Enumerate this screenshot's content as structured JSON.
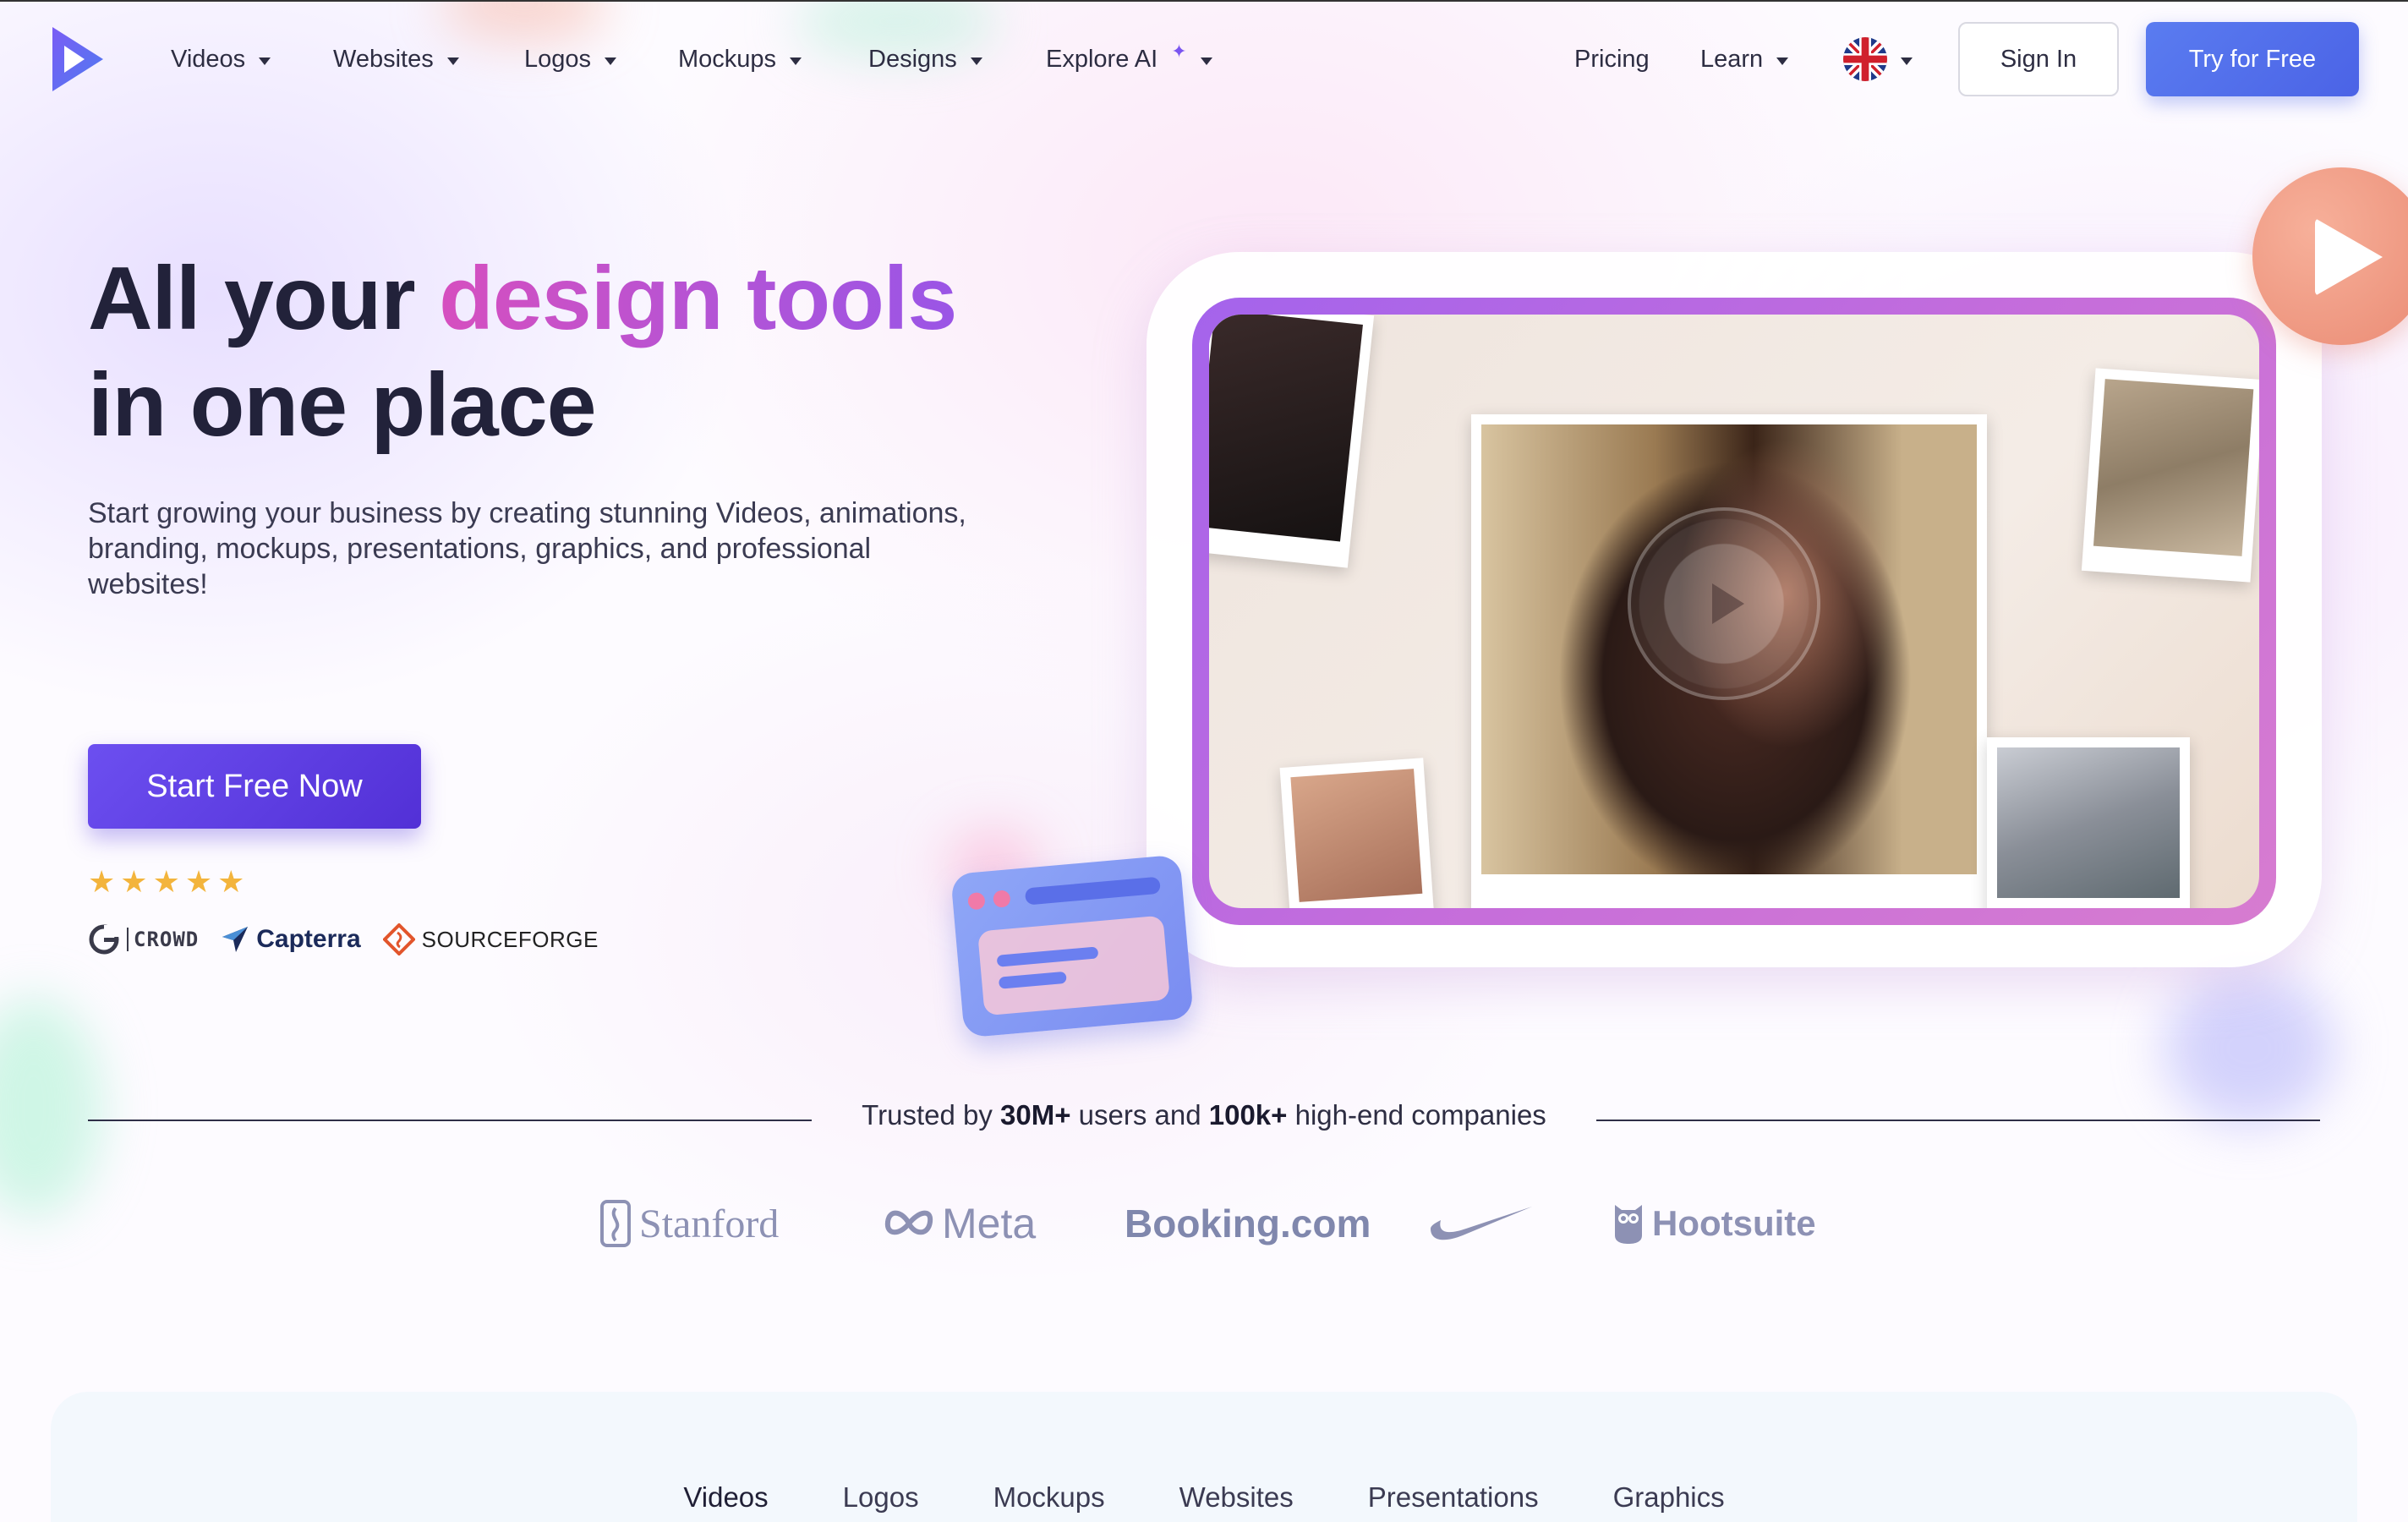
{
  "nav": {
    "items": [
      {
        "label": "Videos"
      },
      {
        "label": "Websites"
      },
      {
        "label": "Logos"
      },
      {
        "label": "Mockups"
      },
      {
        "label": "Designs"
      },
      {
        "label": "Explore AI"
      }
    ],
    "pricing": "Pricing",
    "learn": "Learn",
    "language_flag": "uk-flag-icon",
    "sign_in": "Sign In",
    "try_free": "Try for Free"
  },
  "hero": {
    "title_part1": "All your ",
    "title_highlight": "design tools",
    "title_part2": "in one place",
    "subtitle": "Start growing your business by creating stunning Videos, animations, branding, mockups, presentations, graphics, and professional websites!",
    "cta": "Start Free Now",
    "rating_stars": 5,
    "review_sites": {
      "g2_mark": "G",
      "g2_word": "CROWD",
      "capterra": "Capterra",
      "sourceforge": "SOURCEFORGE"
    }
  },
  "trusted": {
    "prefix": "Trusted by ",
    "users": "30M+",
    "middle": " users and ",
    "companies": "100k+",
    "suffix": " high-end companies"
  },
  "companies": {
    "stanford": "Stanford",
    "meta": "Meta",
    "booking": "Booking.com",
    "nike": "nike-swoosh-logo",
    "hootsuite": "Hootsuite"
  },
  "tabs": [
    "Videos",
    "Logos",
    "Mockups",
    "Websites",
    "Presentations",
    "Graphics"
  ],
  "colors": {
    "accent_blue": "#4b63e6",
    "accent_purple": "#5230d6",
    "highlight_pink": "#d64fbf",
    "highlight_violet": "#9a55e6",
    "star": "#f3b43c"
  }
}
